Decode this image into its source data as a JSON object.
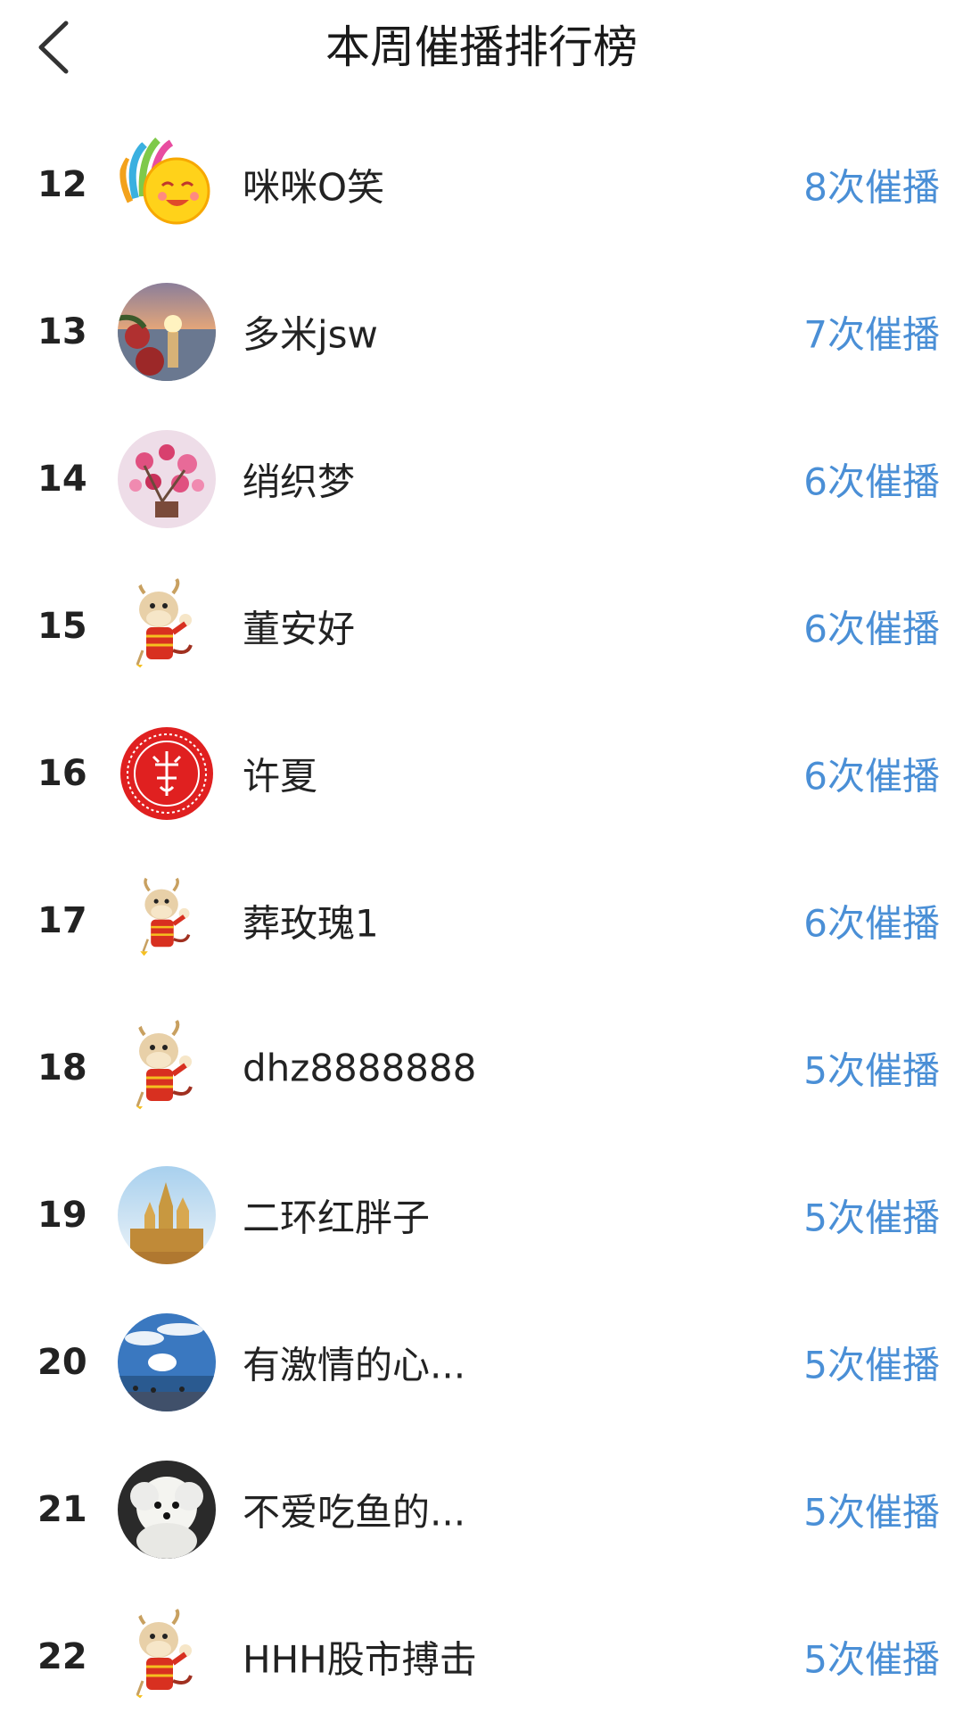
{
  "header": {
    "title": "本周催播排行榜",
    "back_icon": "chevron-left-icon"
  },
  "accent_color": "#4a8fd6",
  "rows": [
    {
      "rank": "12",
      "name": "咪咪O笑",
      "count": "8次催播",
      "avatar": "smiley-sun"
    },
    {
      "rank": "13",
      "name": "多米jsw",
      "count": "7次催播",
      "avatar": "sunset-photo"
    },
    {
      "rank": "14",
      "name": "绡织梦",
      "count": "6次催播",
      "avatar": "flower-photo"
    },
    {
      "rank": "15",
      "name": "董安好",
      "count": "6次催播",
      "avatar": "ox-cartoon"
    },
    {
      "rank": "16",
      "name": "许夏",
      "count": "6次催播",
      "avatar": "red-seal"
    },
    {
      "rank": "17",
      "name": "葬玫瑰1",
      "count": "6次催播",
      "avatar": "ox-cartoon"
    },
    {
      "rank": "18",
      "name": "dhz8888888",
      "count": "5次催播",
      "avatar": "ox-cartoon"
    },
    {
      "rank": "19",
      "name": "二环红胖子",
      "count": "5次催播",
      "avatar": "castle-photo"
    },
    {
      "rank": "20",
      "name": "有激情的心...",
      "count": "5次催播",
      "avatar": "sky-sea-photo"
    },
    {
      "rank": "21",
      "name": "不爱吃鱼的...",
      "count": "5次催播",
      "avatar": "white-dog-photo"
    },
    {
      "rank": "22",
      "name": "HHH股市搏击",
      "count": "5次催播",
      "avatar": "ox-cartoon"
    }
  ]
}
